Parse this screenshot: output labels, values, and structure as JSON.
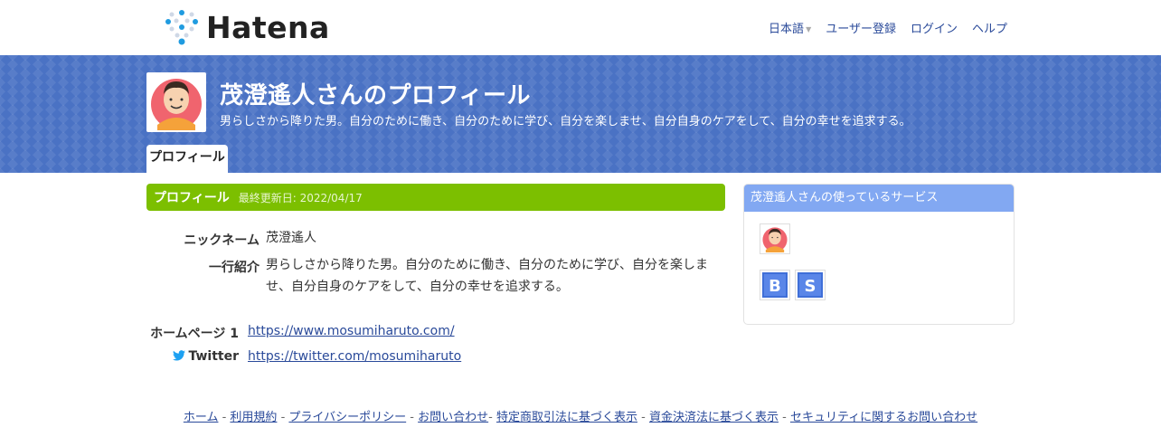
{
  "header": {
    "logo_text": "Hatena",
    "nav": {
      "language": "日本語",
      "register": "ユーザー登録",
      "login": "ログイン",
      "help": "ヘルプ"
    }
  },
  "banner": {
    "title": "茂澄遙人さんのプロフィール",
    "subtitle": "男らしさから降りた男。自分のために働き、自分のために学び、自分を楽しませ、自分自身のケアをして、自分の幸せを追求する。",
    "tab": "プロフィール"
  },
  "profile": {
    "section_title": "プロフィール",
    "updated": "最終更新日: 2022/04/17",
    "fields": {
      "nickname_label": "ニックネーム",
      "nickname_value": "茂澄遙人",
      "intro_label": "一行紹介",
      "intro_line1": "男らしさから降りた男。自分のために働き、自分のために学び、自分を楽しま",
      "intro_line2": "せ、自分自身のケアをして、自分の幸せを追求する。"
    },
    "links": {
      "homepage_label": "ホームページ 1",
      "homepage_url": "https://www.mosumiharuto.com/",
      "twitter_label": "Twitter",
      "twitter_url": "https://twitter.com/mosumiharuto"
    }
  },
  "sidebar": {
    "title": "茂澄遙人さんの使っているサービス",
    "services": [
      "B",
      "S"
    ]
  },
  "footer": {
    "links": [
      "ホーム",
      "利用規約",
      "プライバシーポリシー",
      "お問い合わせ",
      "特定商取引法に基づく表示",
      "資金決済法に基づく表示",
      "セキュリティに関するお問い合わせ"
    ]
  },
  "colors": {
    "banner": "#4a72c4",
    "section_header": "#7cbf00",
    "sidebar_header": "#82a8f2",
    "link": "#2a4a9a"
  }
}
